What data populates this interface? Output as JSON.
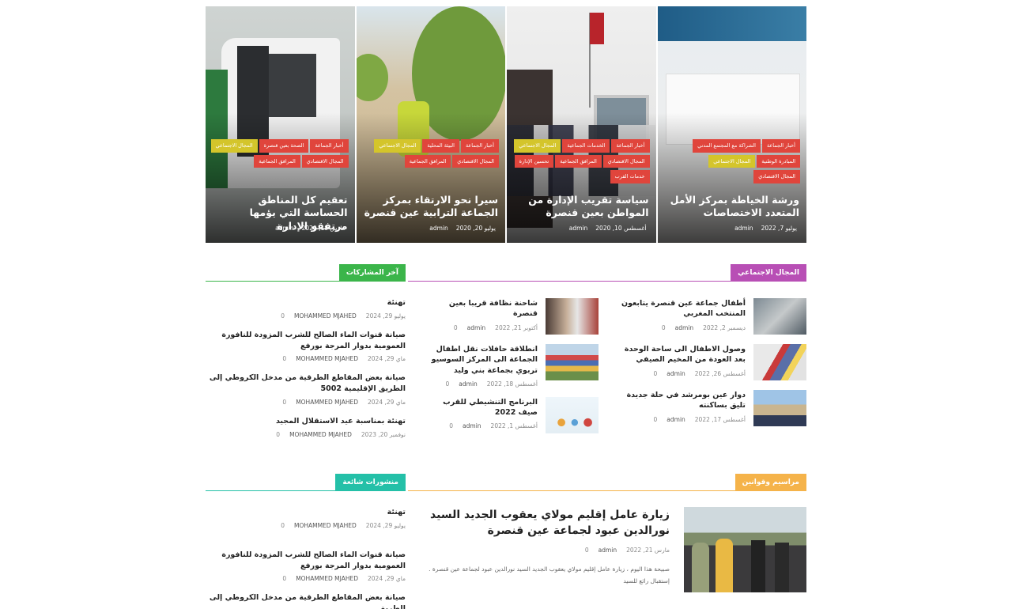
{
  "slider": [
    {
      "title": "ورشة الخياطة بمركز الأمل المتعدد الاختصاصات",
      "date": "يوليو 7, 2022",
      "author": "admin",
      "cats": [
        {
          "label": "أخبار الجماعة",
          "color": "red"
        },
        {
          "label": "الشراكة مع المجتمع المدني",
          "color": "red"
        },
        {
          "label": "المبادرة الوطنية",
          "color": "red"
        },
        {
          "label": "المجال الاجتماعي",
          "color": "yellow"
        },
        {
          "label": "المجال الاقتصادي",
          "color": "red"
        }
      ]
    },
    {
      "title": "سياسة تقريب الإدارة من المواطن بعين قنصرة",
      "date": "أغسطس 10, 2020",
      "author": "admin",
      "cats": [
        {
          "label": "أخبار الجماعة",
          "color": "red"
        },
        {
          "label": "الخدمات الجماعية",
          "color": "red"
        },
        {
          "label": "المجال الاجتماعي",
          "color": "yellow"
        },
        {
          "label": "المجال الاقتصادي",
          "color": "red"
        },
        {
          "label": "المرافق الجماعية",
          "color": "red"
        },
        {
          "label": "تحسين الإدارة",
          "color": "red"
        },
        {
          "label": "خدمات القرب",
          "color": "red"
        }
      ]
    },
    {
      "title": "سيرا نحو الارتقاء بمركز الجماعة الترابية عين قنصرة",
      "date": "يوليو 20, 2020",
      "author": "admin",
      "cats": [
        {
          "label": "أخبار الجماعة",
          "color": "red"
        },
        {
          "label": "البيئة المحلية",
          "color": "red"
        },
        {
          "label": "المجال الاجتماعي",
          "color": "yellow"
        },
        {
          "label": "المجال الاقتصادي",
          "color": "red"
        },
        {
          "label": "المرافق الجماعية",
          "color": "red"
        }
      ]
    },
    {
      "title": "تعقيم كل المناطق الحساسة التي يؤمها مرتفقو الإدارة",
      "date": "مارس 18, 2020",
      "author": "admin",
      "cats": [
        {
          "label": "أخبار الجماعة",
          "color": "red"
        },
        {
          "label": "الصحة بعين قنصرة",
          "color": "red"
        },
        {
          "label": "المجال الاجتماعي",
          "color": "yellow"
        },
        {
          "label": "المجال الاقتصادي",
          "color": "red"
        },
        {
          "label": "المرافق الجماعية",
          "color": "red"
        }
      ]
    }
  ],
  "sections": {
    "social": {
      "label": "المجال الاجتماعي",
      "color": "#b84fb5"
    },
    "latest": {
      "label": "آخر المشاركات",
      "color": "#3bb54a"
    },
    "decrees": {
      "label": "مراسيم وقوانين",
      "color": "#f5b34a"
    },
    "popular": {
      "label": "منشورات شائعة",
      "color": "#24c0a8"
    }
  },
  "social_col_right": [
    {
      "title": "أطفال جماعة عين قنصرة يتابعون المنتخب المغربي",
      "date": "ديسمبر 2, 2022",
      "author": "admin",
      "comments": "0"
    },
    {
      "title": "وصول الاطفال الى ساحة الوحدة بعد العودة من المخيم الصيفي",
      "date": "أغسطس 26, 2022",
      "author": "admin",
      "comments": "0"
    },
    {
      "title": "دوار عين بومرشد في حلة جديدة تليق بساكنته",
      "date": "أغسطس 17, 2022",
      "author": "admin",
      "comments": "0"
    }
  ],
  "social_col_left": [
    {
      "title": "شاحنة نظافة قريبا بعين قنصرة",
      "date": "أكتوبر 21, 2022",
      "author": "admin",
      "comments": "0"
    },
    {
      "title": "انطلاقة حافلات نقل اطفال الجماعة الى المركز السوسيو تربوي بجماعة بني وليد",
      "date": "أغسطس 18, 2022",
      "author": "admin",
      "comments": "0"
    },
    {
      "title": "البرنامج التنشيطي للقرب صيف 2022",
      "date": "أغسطس 1, 2022",
      "author": "admin",
      "comments": "0"
    }
  ],
  "latest_posts": [
    {
      "title": "تهنئة",
      "date": "يوليو 29, 2024",
      "author": "MOHAMMED MJAHED",
      "comments": "0"
    },
    {
      "title": "صيانة قنوات الماء الصالح للشرب المزودة للنافورة العمومية بدوار المرجة بورفع",
      "date": "ماي 29, 2024",
      "author": "MOHAMMED MJAHED",
      "comments": "0"
    },
    {
      "title": "صيانة بعض المقاطع الطرقية من مدخل الكروطي إلى الطريق الإقليمية 5002",
      "date": "ماي 29, 2024",
      "author": "MOHAMMED MJAHED",
      "comments": "0"
    },
    {
      "title": "تهنئة بمناسبة عيد الاستقلال المجيد",
      "date": "نوفمبر 20, 2023",
      "author": "MOHAMMED MJAHED",
      "comments": "0"
    }
  ],
  "featured": {
    "title": "زيارة عامل إقليم مولاي يعقوب الجديد السيد نورالدين عبود لجماعة عين قنصرة",
    "date": "مارس 21, 2022",
    "author": "admin",
    "comments": "0",
    "excerpt": "صبيحة هذا اليوم ، زيارة عامل إقليم مولاي يعقوب الجديد السيد نورالدين عبود لجماعة عين قنصرة . إستقبال رائع للسيد"
  },
  "popular_posts": [
    {
      "title": "تهنئة",
      "date": "يوليو 29, 2024",
      "author": "MOHAMMED MJAHED",
      "comments": "0"
    },
    {
      "title": "صيانة قنوات الماء الصالح للشرب المزودة للنافورة العمومية بدوار المرجة بورفع",
      "date": "ماي 29, 2024",
      "author": "MOHAMMED MJAHED",
      "comments": "0"
    },
    {
      "title": "صيانة بعض المقاطع الطرقية من مدخل الكروطي إلى الطريق",
      "date": "",
      "author": "",
      "comments": ""
    }
  ]
}
